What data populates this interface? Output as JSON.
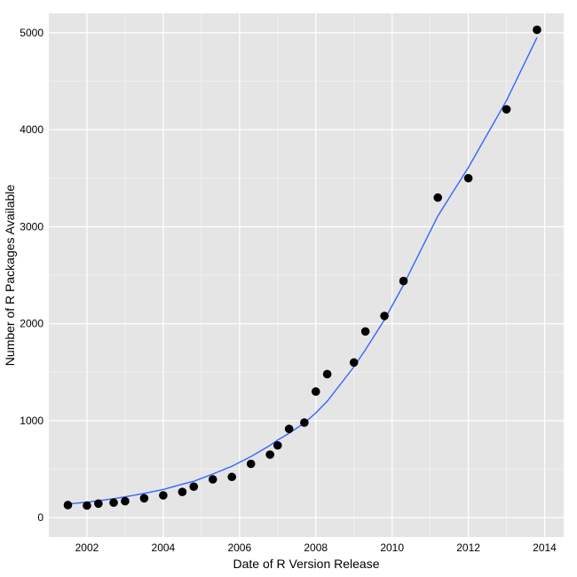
{
  "chart_data": {
    "type": "scatter",
    "title": "",
    "xlabel": "Date of R Version Release",
    "ylabel": "Number of R Packages Available",
    "xlim": [
      2001,
      2014.5
    ],
    "ylim": [
      -200,
      5200
    ],
    "xticks": [
      2002,
      2004,
      2006,
      2008,
      2010,
      2012,
      2014
    ],
    "yticks": [
      0,
      1000,
      2000,
      3000,
      4000,
      5000
    ],
    "x": [
      2001.5,
      2002.0,
      2002.3,
      2002.7,
      2003.0,
      2003.5,
      2004.0,
      2004.5,
      2004.8,
      2005.3,
      2005.8,
      2006.3,
      2006.8,
      2007.0,
      2007.3,
      2007.7,
      2008.0,
      2008.3,
      2009.0,
      2009.3,
      2009.8,
      2010.3,
      2011.2,
      2012.0,
      2013.0,
      2013.8
    ],
    "values": [
      130,
      125,
      145,
      155,
      170,
      200,
      230,
      265,
      320,
      395,
      420,
      555,
      650,
      745,
      915,
      980,
      1300,
      1480,
      1600,
      1920,
      2080,
      2440,
      3300,
      3500,
      4210,
      5030
    ],
    "fit": [
      140,
      160,
      175,
      195,
      215,
      250,
      290,
      345,
      375,
      450,
      530,
      630,
      745,
      800,
      870,
      975,
      1080,
      1200,
      1555,
      1730,
      2040,
      2400,
      3110,
      3610,
      4300,
      4950
    ]
  }
}
